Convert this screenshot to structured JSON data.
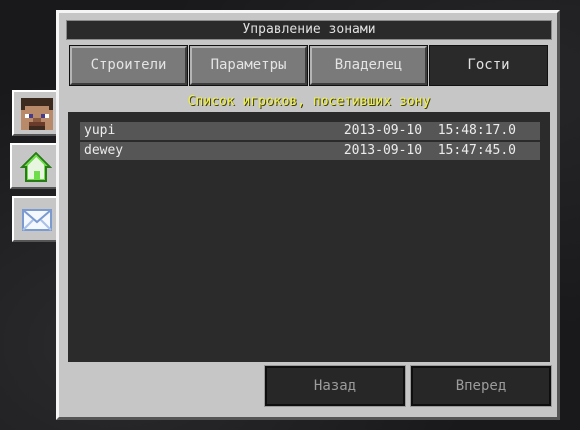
{
  "window": {
    "title": "Управление зонами"
  },
  "tabs": [
    {
      "label": "Строители"
    },
    {
      "label": "Параметры"
    },
    {
      "label": "Владелец"
    },
    {
      "label": "Гости"
    }
  ],
  "active_tab": "Гости",
  "subtitle": "Список игроков, посетивших зону",
  "visitors": [
    {
      "name": "yupi",
      "time": "2013-09-10  15:48:17.0"
    },
    {
      "name": "dewey",
      "time": "2013-09-10  15:47:45.0"
    }
  ],
  "buttons": {
    "back": "Назад",
    "forward": "Вперед"
  },
  "side_tabs": [
    {
      "icon": "player-head-icon"
    },
    {
      "icon": "house-icon"
    },
    {
      "icon": "mail-icon"
    }
  ]
}
